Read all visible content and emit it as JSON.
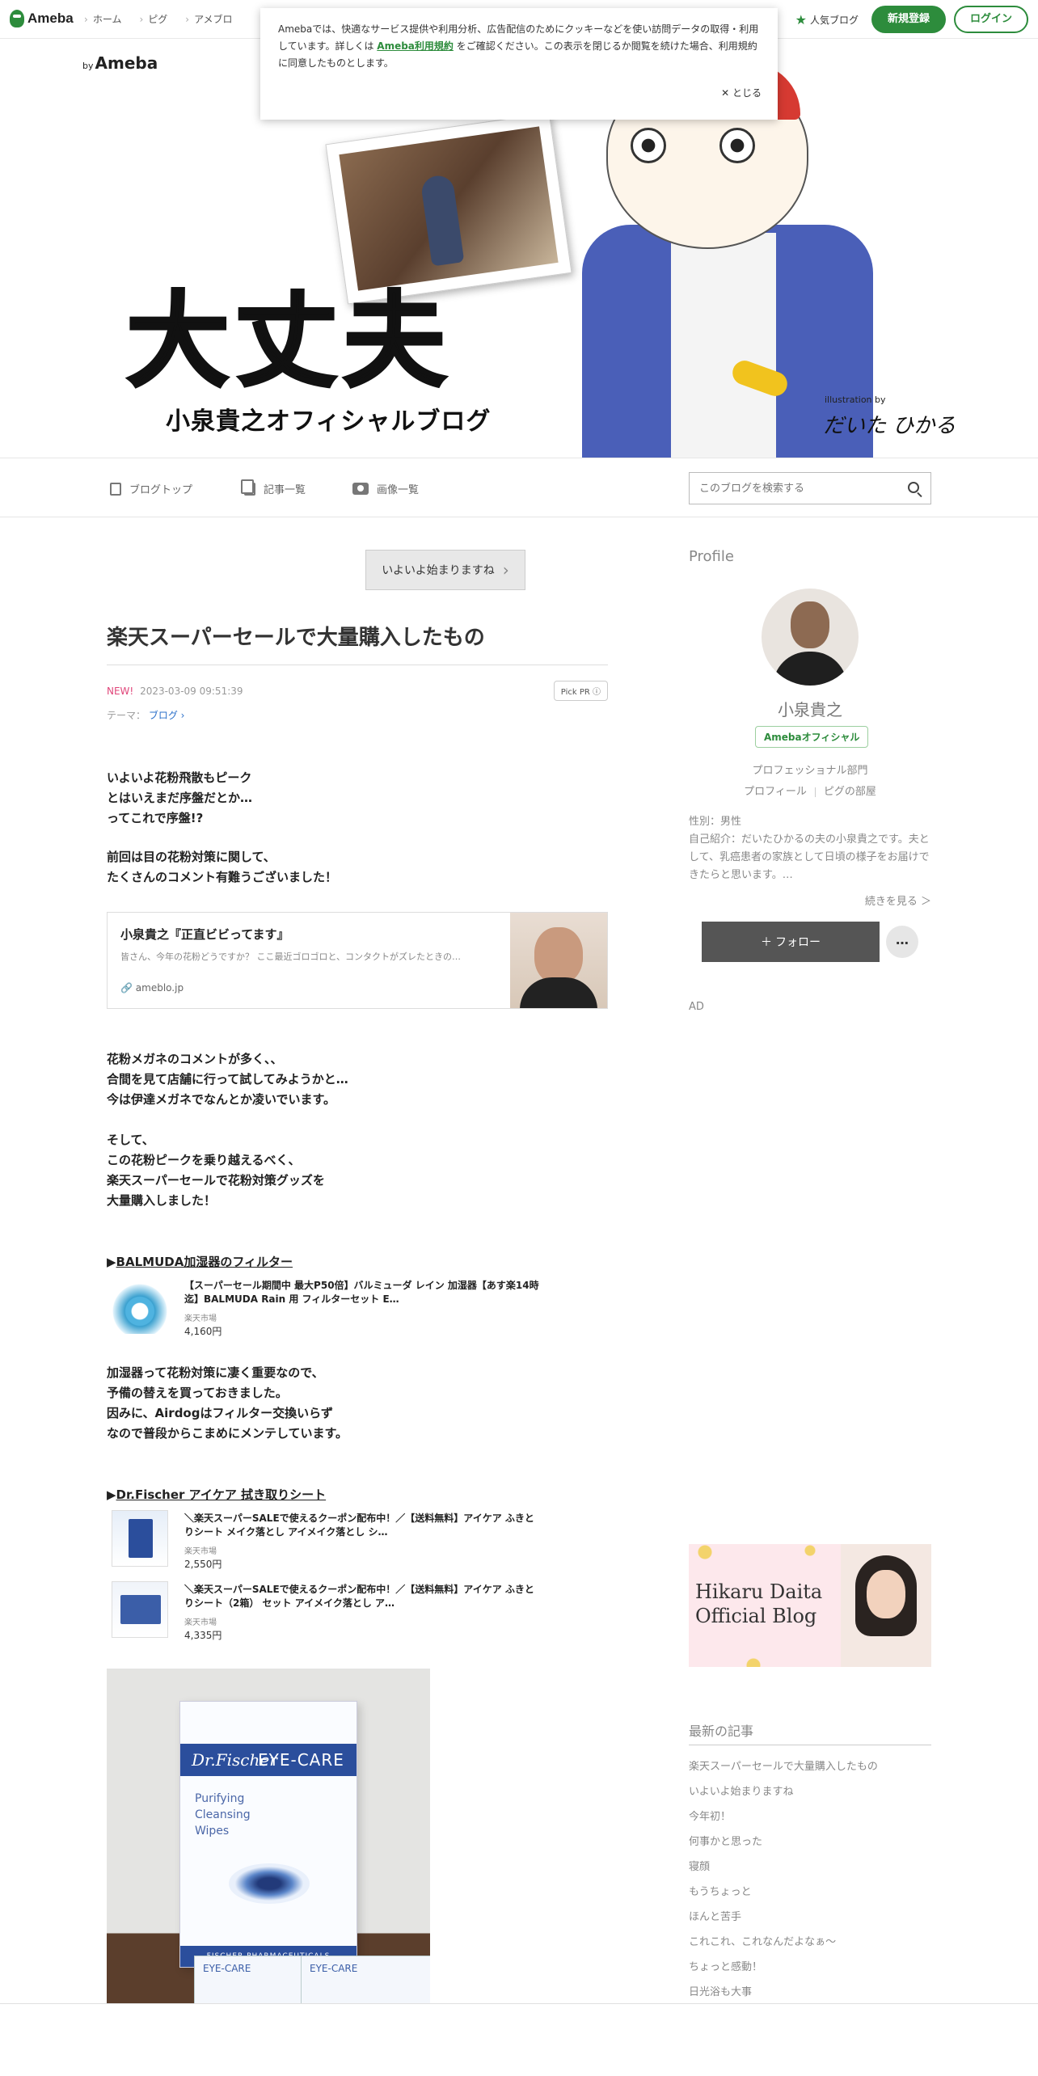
{
  "global_header": {
    "logo": "Ameba",
    "nav": [
      "ホーム",
      "ピグ",
      "アメブロ"
    ],
    "popular": "人気ブログ",
    "register": "新規登録",
    "login": "ログイン"
  },
  "cookie_notice": {
    "text_before": "Amebaでは、快適なサービス提供や利用分析、広告配信のためにクッキーなどを使い訪問データの取得・利用しています。詳しくは",
    "terms_link": "Ameba利用規約",
    "text_after": "をご確認ください。この表示を閉じるか閲覧を続けた場合、利用規約に同意したものとします。",
    "close": "✕ とじる"
  },
  "blog_header": {
    "by_prefix": "by",
    "by_brand": "Ameba",
    "title": "大丈夫",
    "subtitle": "小泉貴之オフィシャルブログ",
    "illustration_by": "illustration by",
    "illustrator": "だいた ひかる"
  },
  "blog_nav": {
    "items": [
      "ブログトップ",
      "記事一覧",
      "画像一覧"
    ],
    "search_placeholder": "このブログを検索する"
  },
  "article": {
    "prev_link": "いよいよ始まりますね",
    "title": "楽天スーパーセールで大量購入したもの",
    "new_label": "NEW!",
    "datetime": "2023-03-09 09:51:39",
    "pickpr": "Pick PR ⓘ",
    "theme_label": "テーマ：",
    "theme": "ブログ",
    "para1": "いよいよ花粉飛散もピーク\nとはいえまだ序盤だとか…\nってこれで序盤!?",
    "para2": "前回は目の花粉対策に関して、\nたくさんのコメント有難うございました！",
    "link_card": {
      "title": "小泉貴之『正直ビビってます』",
      "desc": "皆さん、今年の花粉どうですか？ ここ最近ゴロゴロと、コンタクトがズレたときの…",
      "domain": "ameblo.jp"
    },
    "para3": "花粉メガネのコメントが多く、、\n合間を見て店舗に行って試してみようかと…\n今は伊達メガネでなんとか凌いでいます。",
    "para4": "そして、\nこの花粉ピークを乗り越えるべく、\n楽天スーパーセールで花粉対策グッズを\n大量購入しました！",
    "section1": {
      "prefix": "▶",
      "title": "BALMUDA加湿器のフィルター",
      "products": [
        {
          "title": "【スーパーセール期間中 最大P50倍】バルミューダ レイン 加湿器【あす楽14時迄】BALMUDA Rain 用 フィルターセット E…",
          "shop": "楽天市場",
          "price": "4,160円"
        }
      ]
    },
    "para5": "加湿器って花粉対策に凄く重要なので、\n予備の替えを買っておきました。\n因みに、Airdogはフィルター交換いらず\nなので普段からこまめにメンテしています。",
    "section2": {
      "prefix": "▶",
      "title": "Dr.Fischer アイケア 拭き取りシート",
      "products": [
        {
          "title": "＼楽天スーパーSALEで使えるクーポン配布中！／【送料無料】アイケア ふきとりシート メイク落とし アイメイク落とし シ…",
          "shop": "楽天市場",
          "price": "2,550円"
        },
        {
          "title": "＼楽天スーパーSALEで使えるクーポン配布中！／【送料無料】アイケア ふきとりシート（2箱） セット アイメイク落とし ア…",
          "shop": "楽天市場",
          "price": "4,335円"
        }
      ]
    },
    "photo": {
      "brand": "Dr.Fischer",
      "product": "EYE-CARE",
      "desc": "Purifying\nCleansing\nWipes",
      "band": "FISCHER PHARMACEUTICALS",
      "sachet": "EYE-CARE"
    }
  },
  "sidebar": {
    "profile_head": "Profile",
    "name": "小泉貴之",
    "official": "Amebaオフィシャル",
    "category": "プロフェッショナル部門",
    "links": [
      "プロフィール",
      "ピグの部屋"
    ],
    "detail": "性別：男性\n自己紹介：だいたひかるの夫の小泉貴之です。夫として、乳癌患者の家族として日頃の様子をお届けできたらと思います。…",
    "read_more": "続きを見る ＞",
    "follow": "フォロー",
    "more": "…",
    "ad": "AD",
    "banner": "Hikaru Daita\nOfficial Blog",
    "latest_head": "最新の記事",
    "latest": [
      "楽天スーパーセールで大量購入したもの",
      "いよいよ始まりますね",
      "今年初！",
      "何事かと思った",
      "寝顔",
      "もうちょっと",
      "ほんと苦手",
      "これこれ、これなんだよなぁ〜",
      "ちょっと感動！",
      "日光浴も大事"
    ]
  }
}
